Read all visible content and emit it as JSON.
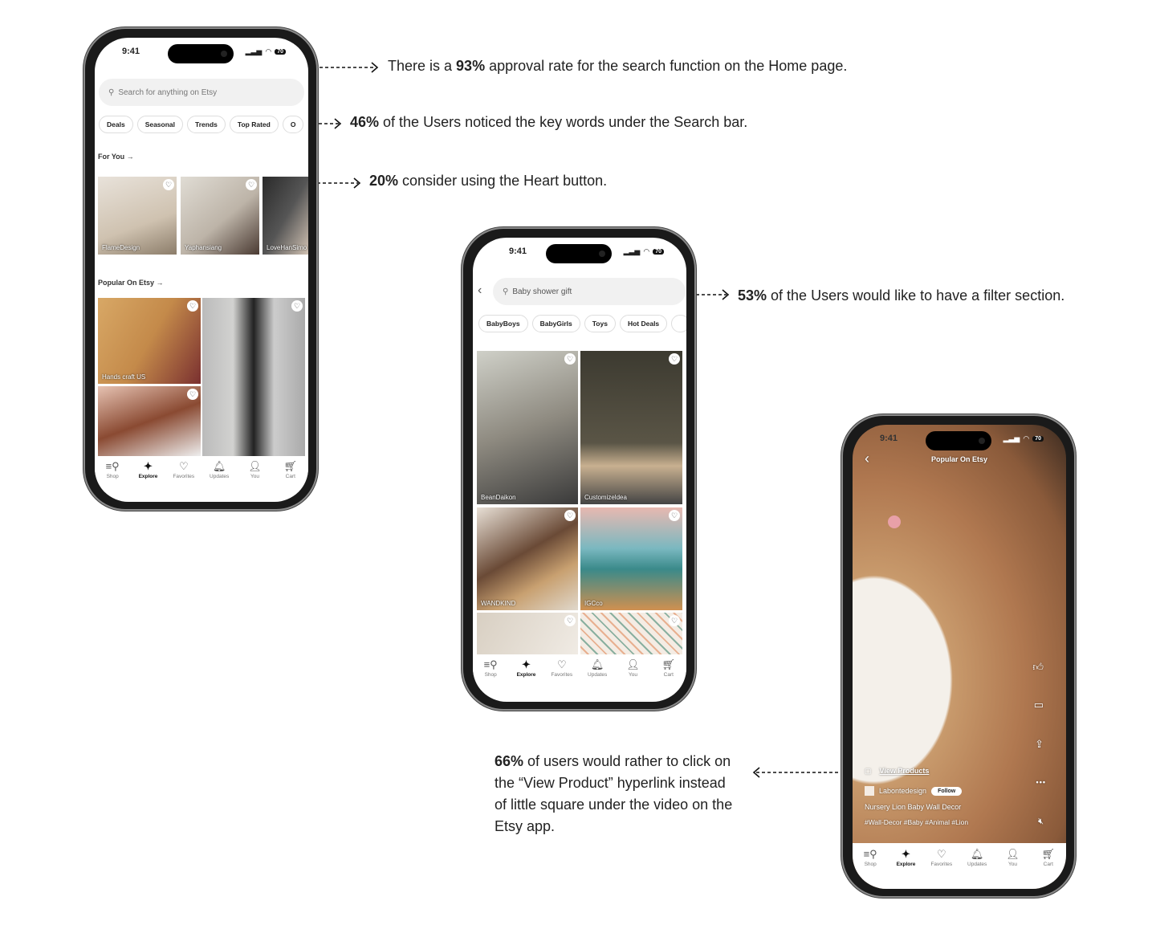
{
  "status": {
    "time": "9:41",
    "battery": "70"
  },
  "tabs": [
    {
      "label": "Shop",
      "icon": "shop-search-icon"
    },
    {
      "label": "Explore",
      "icon": "sparkle-icon"
    },
    {
      "label": "Favorites",
      "icon": "heart-icon"
    },
    {
      "label": "Updates",
      "icon": "bell-icon"
    },
    {
      "label": "You",
      "icon": "user-icon"
    },
    {
      "label": "Cart",
      "icon": "cart-icon"
    }
  ],
  "home": {
    "search_placeholder": "Search for anything on Etsy",
    "chips": [
      "Deals",
      "Seasonal",
      "Trends",
      "Top Rated",
      "O"
    ],
    "for_you": "For You",
    "for_you_items": [
      "FlameDesign",
      "Yaphansiang",
      "LoveHanSimo"
    ],
    "popular": "Popular On Etsy",
    "popular_items": [
      "Hands craft US",
      "",
      ""
    ]
  },
  "search": {
    "query": "Baby shower gift",
    "chips": [
      "BabyBoys",
      "BabyGirls",
      "Toys",
      "Hot Deals",
      ""
    ],
    "results": [
      "BeanDaikon",
      "Customizeldea",
      "WANDKIND",
      "IGCco",
      "",
      ""
    ]
  },
  "video": {
    "title": "Popular On Etsy",
    "view_products": "View Products",
    "shop": "Labontedesign",
    "follow": "Follow",
    "product": "Nursery Lion Baby Wall Decor",
    "tags": "#Wall-Decor #Baby #Animal #Lion"
  },
  "notes": [
    {
      "pct": "93%",
      "pre": "There is a ",
      "post": " approval rate for the search function on the Home page."
    },
    {
      "pct": "46%",
      "pre": "",
      "post": " of the Users noticed the key words under the Search bar."
    },
    {
      "pct": "20%",
      "pre": "",
      "post": " consider using the Heart button."
    },
    {
      "pct": "53%",
      "pre": "",
      "post": " of the Users would like to have a filter section."
    },
    {
      "pct": "66%",
      "pre": "",
      "post": " of users would rather to click on the “View Product” hyperlink  instead of little square under the video on the Etsy app."
    }
  ]
}
